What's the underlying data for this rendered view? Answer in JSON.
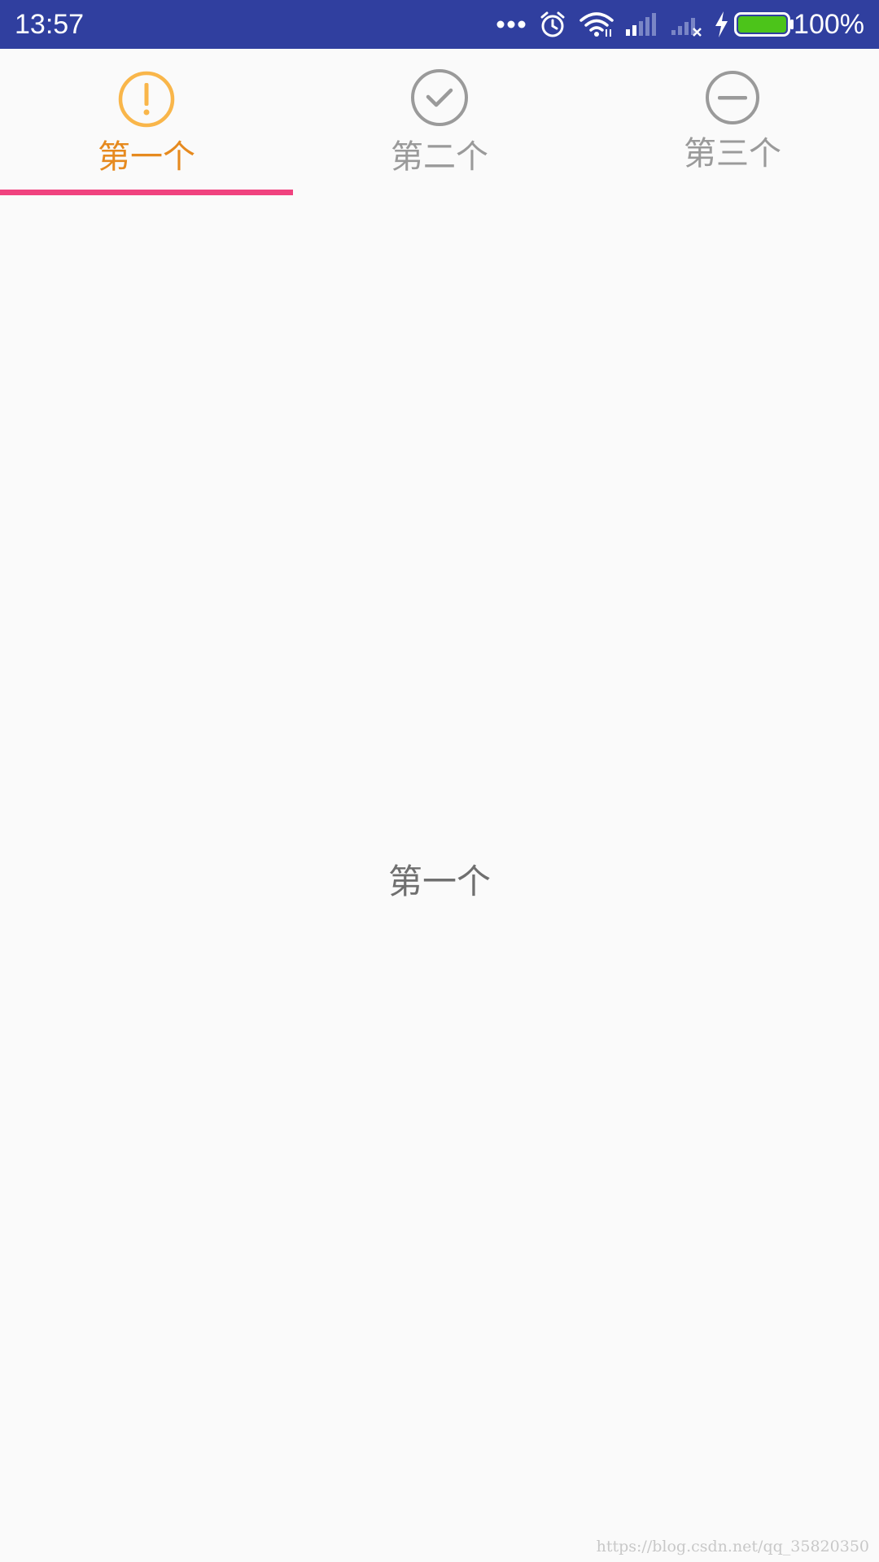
{
  "status_bar": {
    "time": "13:57",
    "battery_percent": "100%",
    "battery_level": 1.0,
    "icons": [
      "more-dots-icon",
      "alarm-icon",
      "wifi-icon",
      "signal-icon",
      "signal-no-service-icon",
      "charging-icon",
      "battery-icon"
    ],
    "background": "#303f9f",
    "battery_color": "#4cc41a"
  },
  "tabs": [
    {
      "label": "第一个",
      "icon": "alert-circle-icon",
      "selected": true,
      "color": "#e68a1f",
      "icon_color": "#f9b64a"
    },
    {
      "label": "第二个",
      "icon": "check-circle-icon",
      "selected": false,
      "color": "#9a9a9a",
      "icon_color": "#9a9a9a"
    },
    {
      "label": "第三个",
      "icon": "minus-circle-icon",
      "selected": false,
      "color": "#9a9a9a",
      "icon_color": "#9a9a9a"
    }
  ],
  "indicator_color": "#f0437f",
  "content": {
    "text": "第一个"
  },
  "watermark": "https://blog.csdn.net/qq_35820350"
}
